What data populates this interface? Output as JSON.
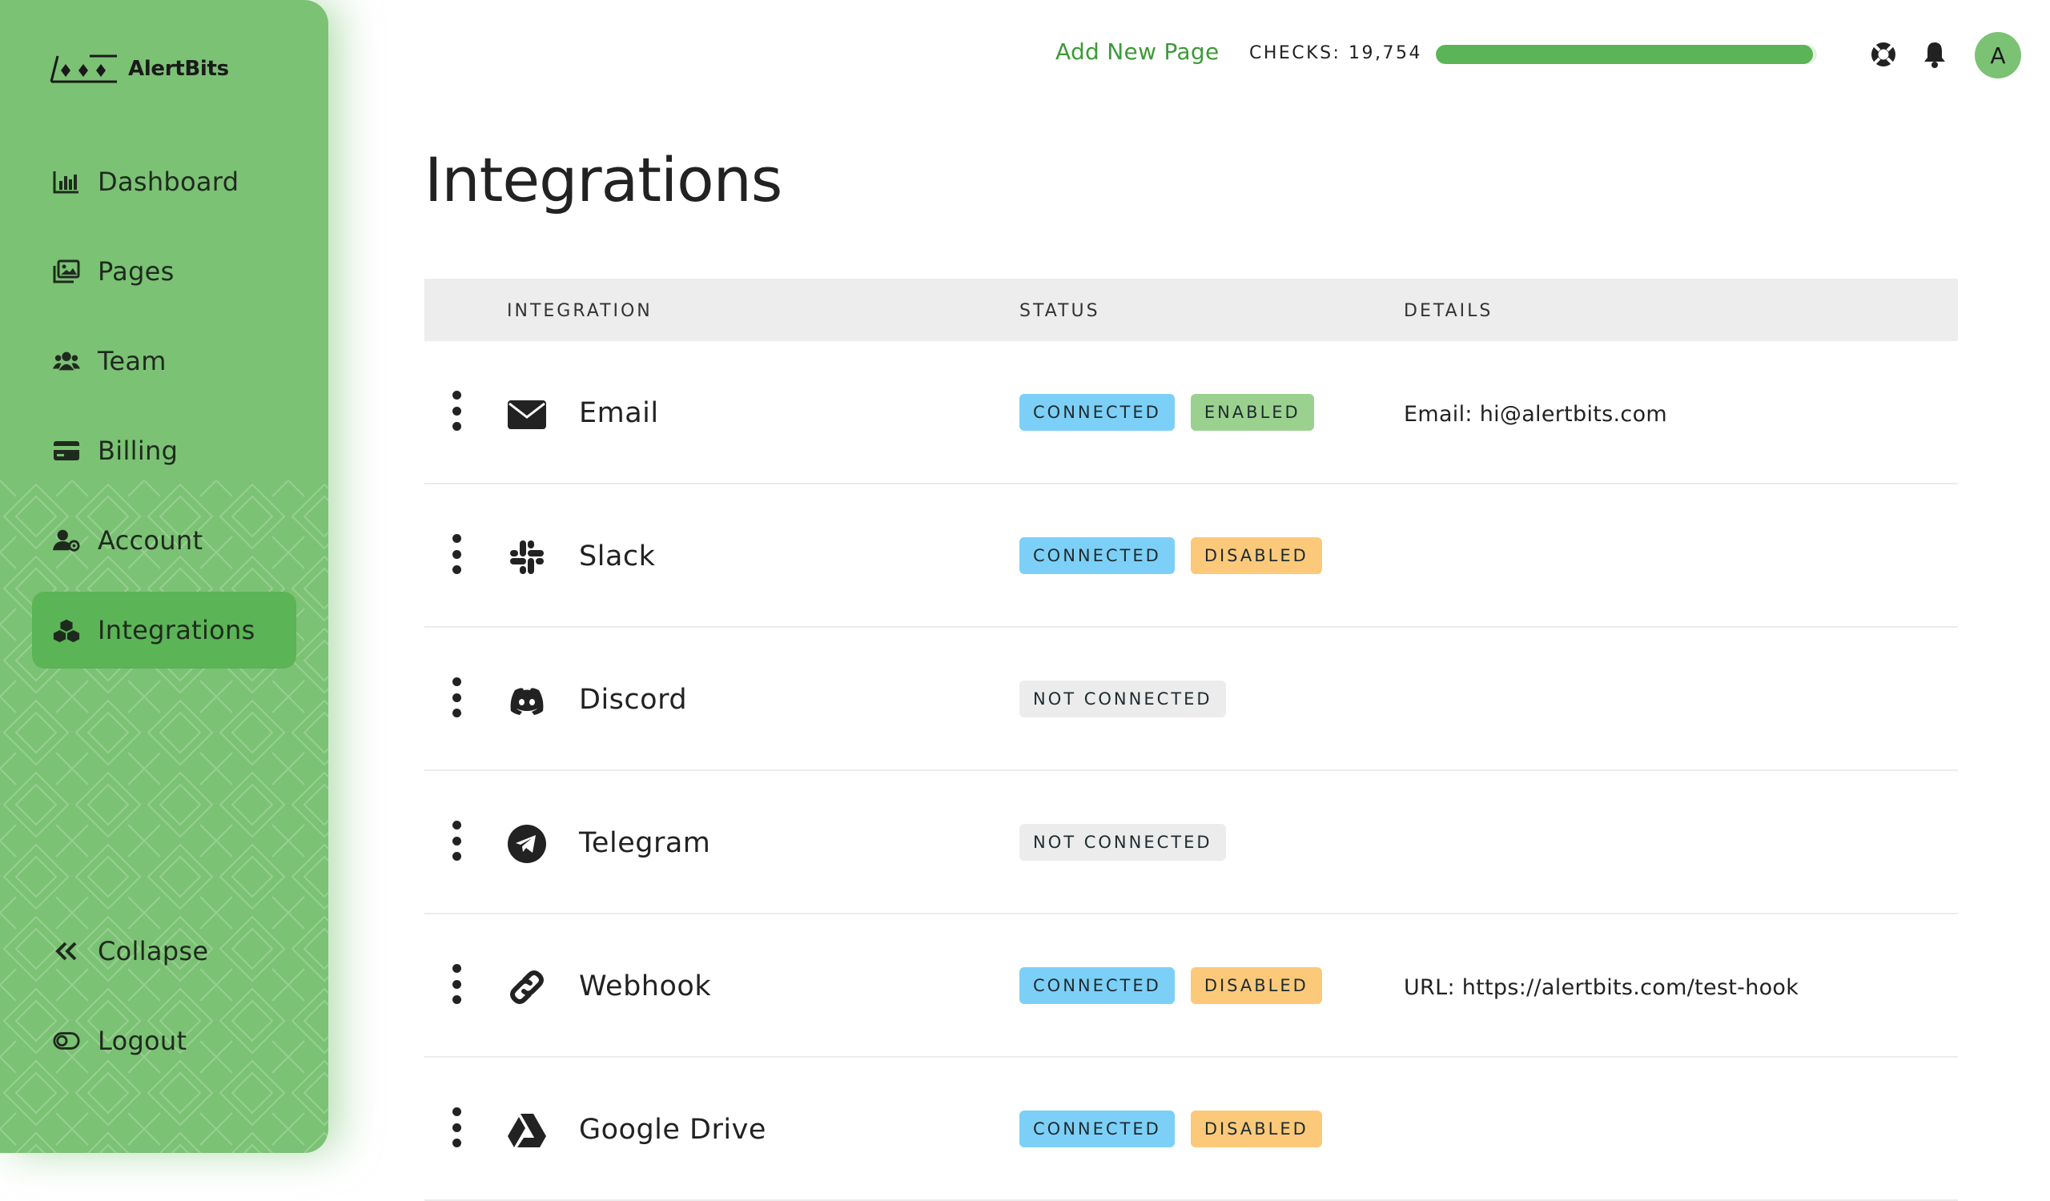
{
  "app": {
    "name": "AlertBits",
    "accent_color": "#7bc274",
    "accent_dark": "#5bb456",
    "link_color": "#3d9a38"
  },
  "sidebar": {
    "items": [
      {
        "label": "Dashboard",
        "icon": "bar-chart-icon",
        "active": false
      },
      {
        "label": "Pages",
        "icon": "images-icon",
        "active": false
      },
      {
        "label": "Team",
        "icon": "users-icon",
        "active": false
      },
      {
        "label": "Billing",
        "icon": "credit-card-icon",
        "active": false
      },
      {
        "label": "Account",
        "icon": "user-gear-icon",
        "active": false
      },
      {
        "label": "Integrations",
        "icon": "cubes-icon",
        "active": true
      }
    ],
    "bottom": [
      {
        "label": "Collapse",
        "icon": "double-chevron-left-icon"
      },
      {
        "label": "Logout",
        "icon": "toggle-icon"
      }
    ]
  },
  "topbar": {
    "add_page": "Add New Page",
    "checks": "CHECKS: 19,754",
    "progress_fraction": 0.99,
    "avatar_initial": "A",
    "icons": [
      "lifebuoy-icon",
      "bell-icon"
    ]
  },
  "main": {
    "title": "Integrations",
    "table": {
      "headers": {
        "integration": "INTEGRATION",
        "status": "STATUS",
        "details": "DETAILS"
      },
      "rows": [
        {
          "name": "Email",
          "icon": "envelope-icon",
          "badges": [
            {
              "text": "CONNECTED",
              "kind": "connected"
            },
            {
              "text": "ENABLED",
              "kind": "enabled"
            }
          ],
          "details": "Email: hi@alertbits.com"
        },
        {
          "name": "Slack",
          "icon": "slack-icon",
          "badges": [
            {
              "text": "CONNECTED",
              "kind": "connected"
            },
            {
              "text": "DISABLED",
              "kind": "disabled"
            }
          ],
          "details": ""
        },
        {
          "name": "Discord",
          "icon": "discord-icon",
          "badges": [
            {
              "text": "NOT CONNECTED",
              "kind": "notconnected"
            }
          ],
          "details": ""
        },
        {
          "name": "Telegram",
          "icon": "telegram-icon",
          "badges": [
            {
              "text": "NOT CONNECTED",
              "kind": "notconnected"
            }
          ],
          "details": ""
        },
        {
          "name": "Webhook",
          "icon": "link-icon",
          "badges": [
            {
              "text": "CONNECTED",
              "kind": "connected"
            },
            {
              "text": "DISABLED",
              "kind": "disabled"
            }
          ],
          "details": "URL: https://alertbits.com/test-hook"
        },
        {
          "name": "Google Drive",
          "icon": "google-drive-icon",
          "badges": [
            {
              "text": "CONNECTED",
              "kind": "connected"
            },
            {
              "text": "DISABLED",
              "kind": "disabled"
            }
          ],
          "details": ""
        }
      ]
    }
  }
}
